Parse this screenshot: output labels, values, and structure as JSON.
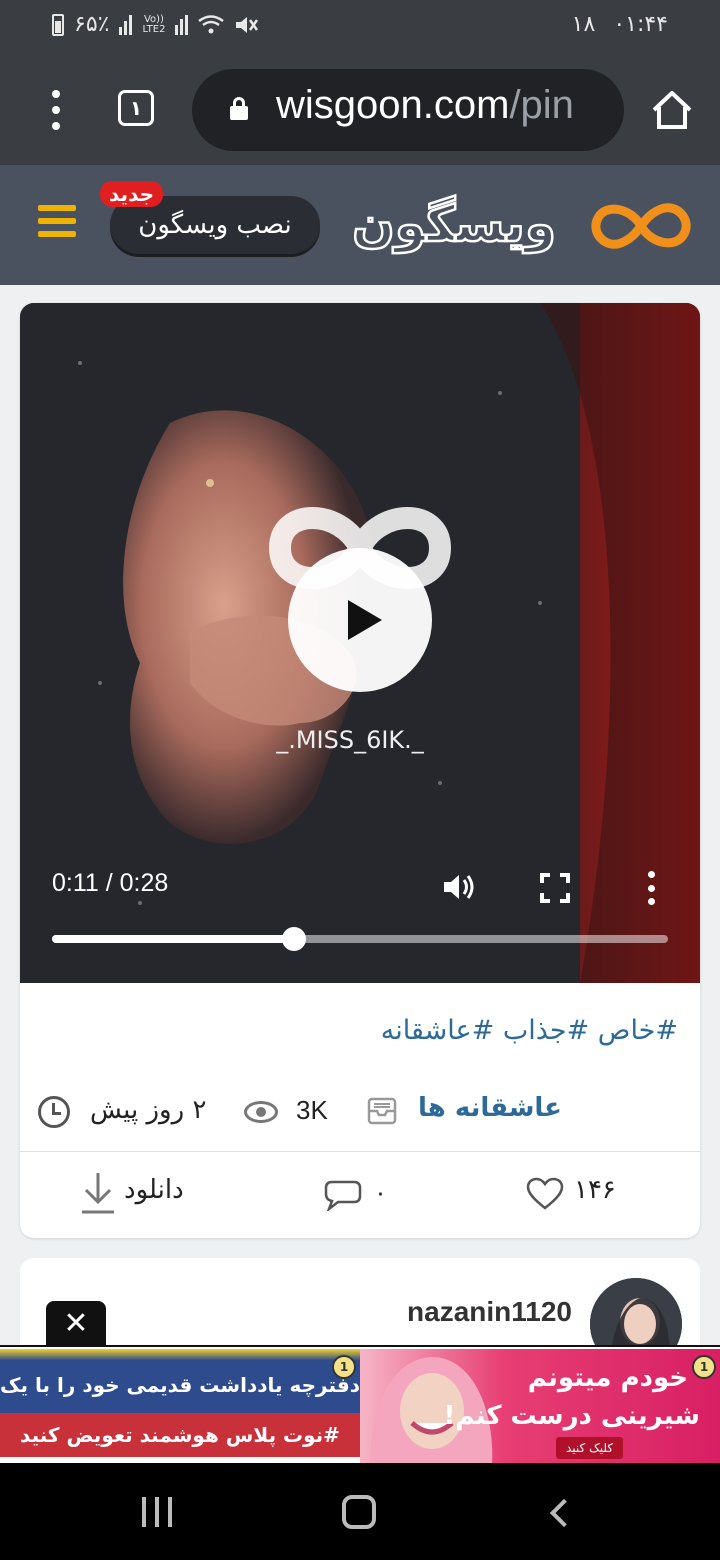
{
  "status_bar": {
    "battery": "۶۵٪",
    "network": "LTE2",
    "volte": "Vo))",
    "date": "۱۸",
    "time": "۰۱:۴۴"
  },
  "browser": {
    "tab_count": "۱",
    "url_host": "wisgoon.com",
    "url_path": "/pin"
  },
  "site_header": {
    "install_label": "نصب ویسگون",
    "new_badge": "جدید",
    "wordmark": "ویسگون",
    "brand_color": "#f0b400"
  },
  "post": {
    "video": {
      "time_label": "0:11 / 0:28",
      "progress": 0.393,
      "watermark": "_.MISS_6IK._"
    },
    "tags": "#خاص #جذاب #عاشقانه",
    "category": "عاشقانه ها",
    "views": "3K",
    "posted_ago": "۲ روز پیش",
    "download_label": "دانلود",
    "comments_count": "۰",
    "likes_count": "۱۴۶"
  },
  "next_post": {
    "username": "nazanin1120"
  },
  "ad": {
    "close": "✕",
    "left_line1": "دفترچه یادداشت قدیمی خود را با یک",
    "left_line2": "#نوت پلاس هوشمند تعویض کنید",
    "right_line1": "خودم میتونم",
    "right_line2": "شیرینی درست کنم!",
    "right_cta": "کلیک کنید",
    "badge": "1"
  }
}
